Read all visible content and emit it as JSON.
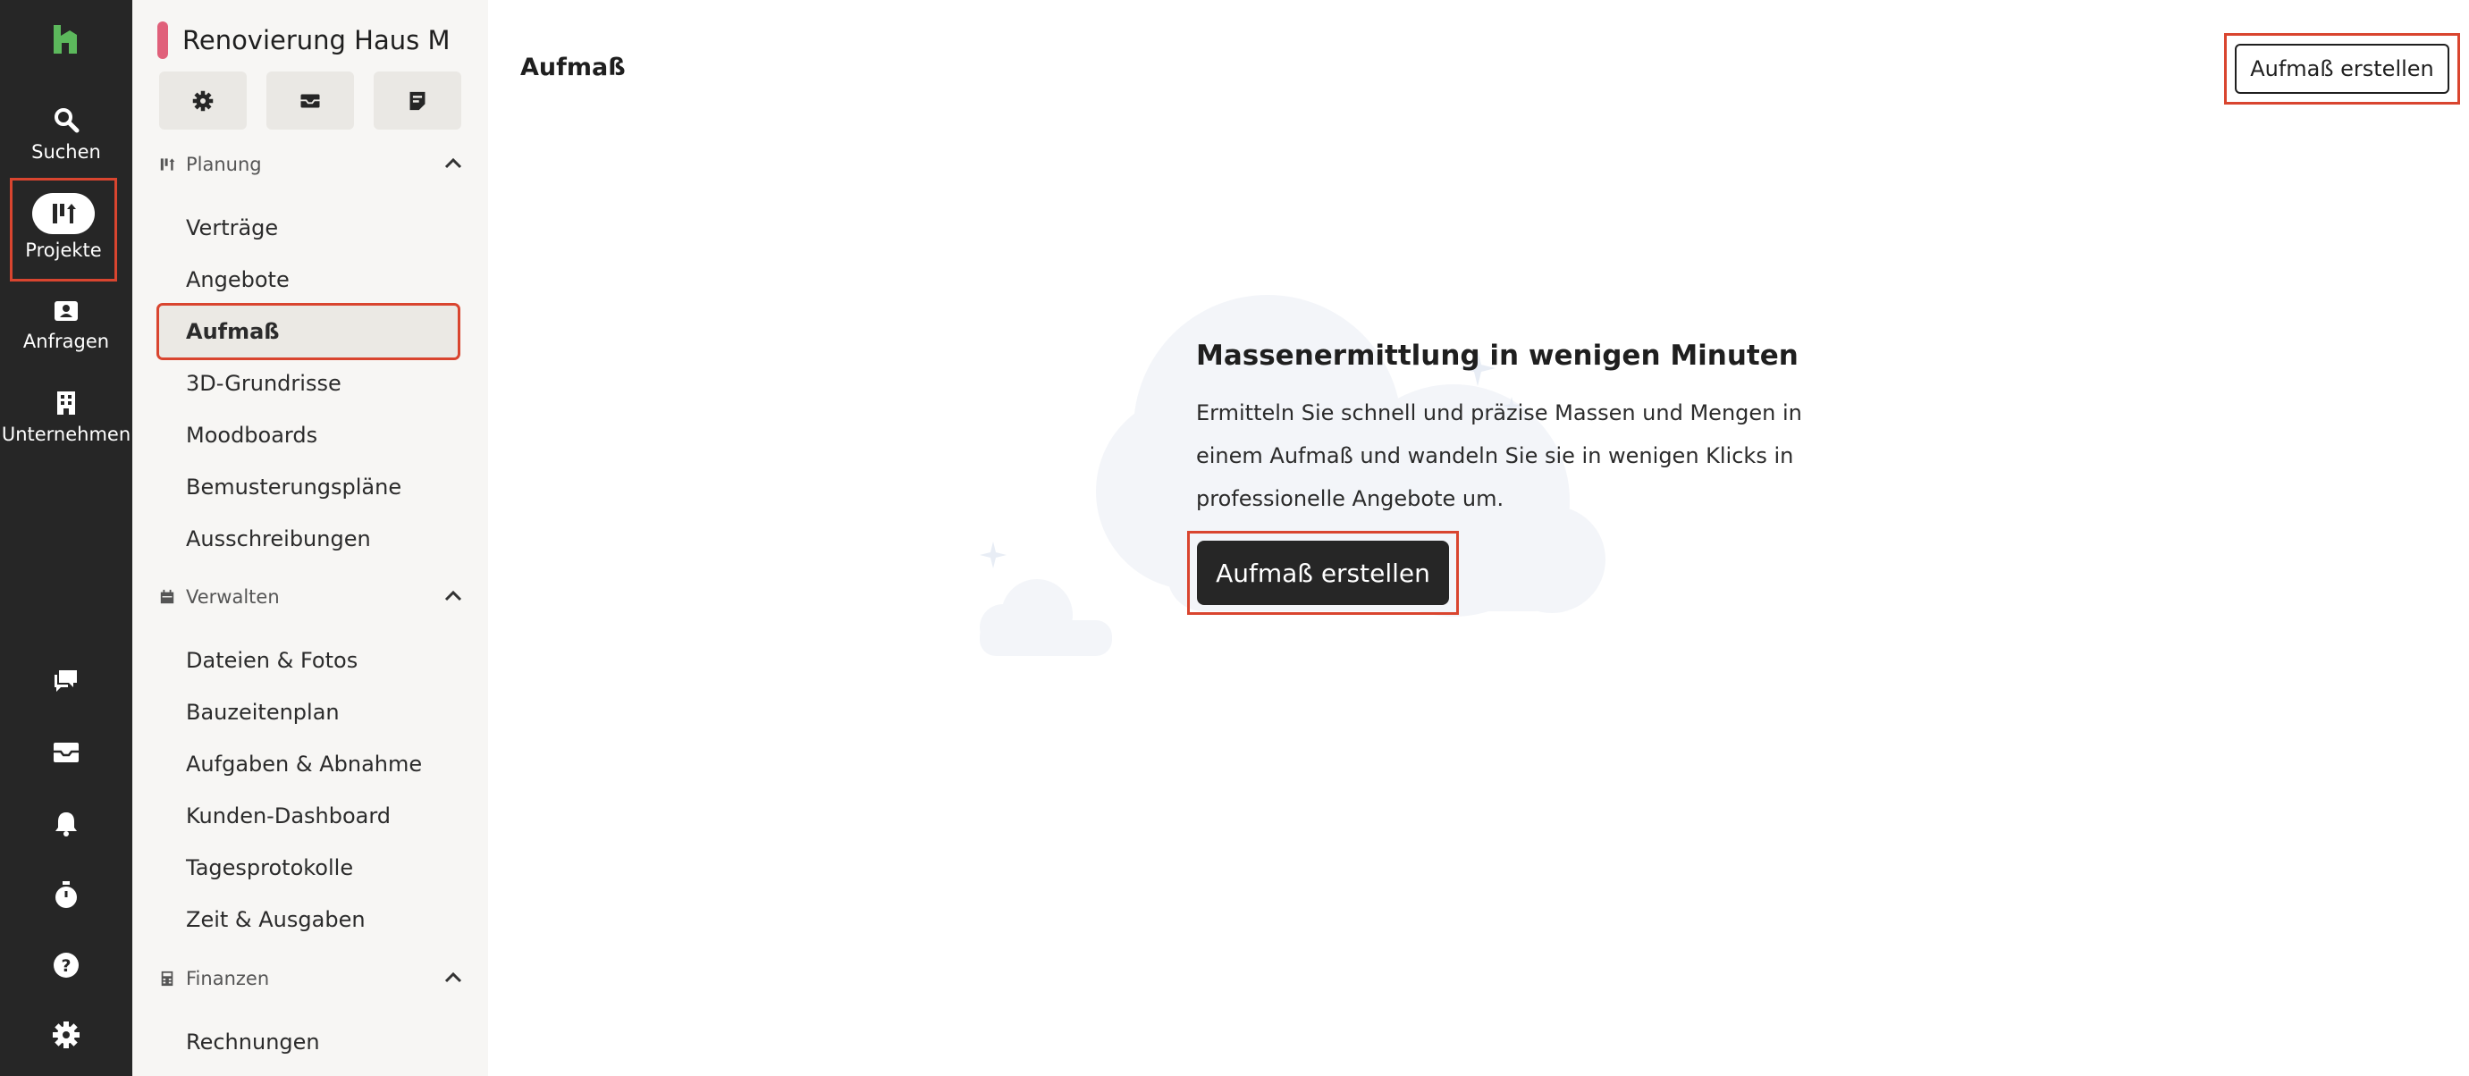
{
  "rail": {
    "items": [
      {
        "label": "Suchen",
        "icon": "search-icon"
      },
      {
        "label": "Projekte",
        "icon": "projects-icon"
      },
      {
        "label": "Anfragen",
        "icon": "contact-card-icon"
      },
      {
        "label": "Unternehmen",
        "icon": "building-icon"
      }
    ],
    "bottom_icons": [
      "chat-icon",
      "inbox-icon",
      "bell-icon",
      "timer-icon",
      "help-icon",
      "gear-icon"
    ]
  },
  "sidebar": {
    "project_name": "Renovierung Haus M",
    "project_color": "#e0607a",
    "toolbar_icons": [
      "gear-icon",
      "mail-icon",
      "note-icon"
    ],
    "sections": [
      {
        "title": "Planung",
        "items": [
          "Verträge",
          "Angebote",
          "Aufmaß",
          "3D-Grundrisse",
          "Moodboards",
          "Bemusterungspläne",
          "Ausschreibungen"
        ]
      },
      {
        "title": "Verwalten",
        "items": [
          "Dateien & Fotos",
          "Bauzeitenplan",
          "Aufgaben & Abnahme",
          "Kunden-Dashboard",
          "Tagesprotokolle",
          "Zeit & Ausgaben"
        ]
      },
      {
        "title": "Finanzen",
        "items": [
          "Rechnungen"
        ]
      }
    ],
    "active_item": "Aufmaß"
  },
  "main": {
    "page_title": "Aufmaß",
    "top_button_label": "Aufmaß erstellen",
    "empty_state": {
      "title": "Massenermittlung in wenigen Minuten",
      "desc_lines": [
        "Ermitteln Sie schnell und präzise Massen und Mengen in",
        "einem Aufmaß und wandeln Sie sie in wenigen Klicks in",
        "professionelle Angebote um."
      ],
      "cta_label": "Aufmaß erstellen"
    }
  },
  "colors": {
    "rail_bg": "#262626",
    "brand_green": "#5cb85c",
    "highlight_red": "#d9452f",
    "sidebar_bg": "#f7f6f4"
  }
}
